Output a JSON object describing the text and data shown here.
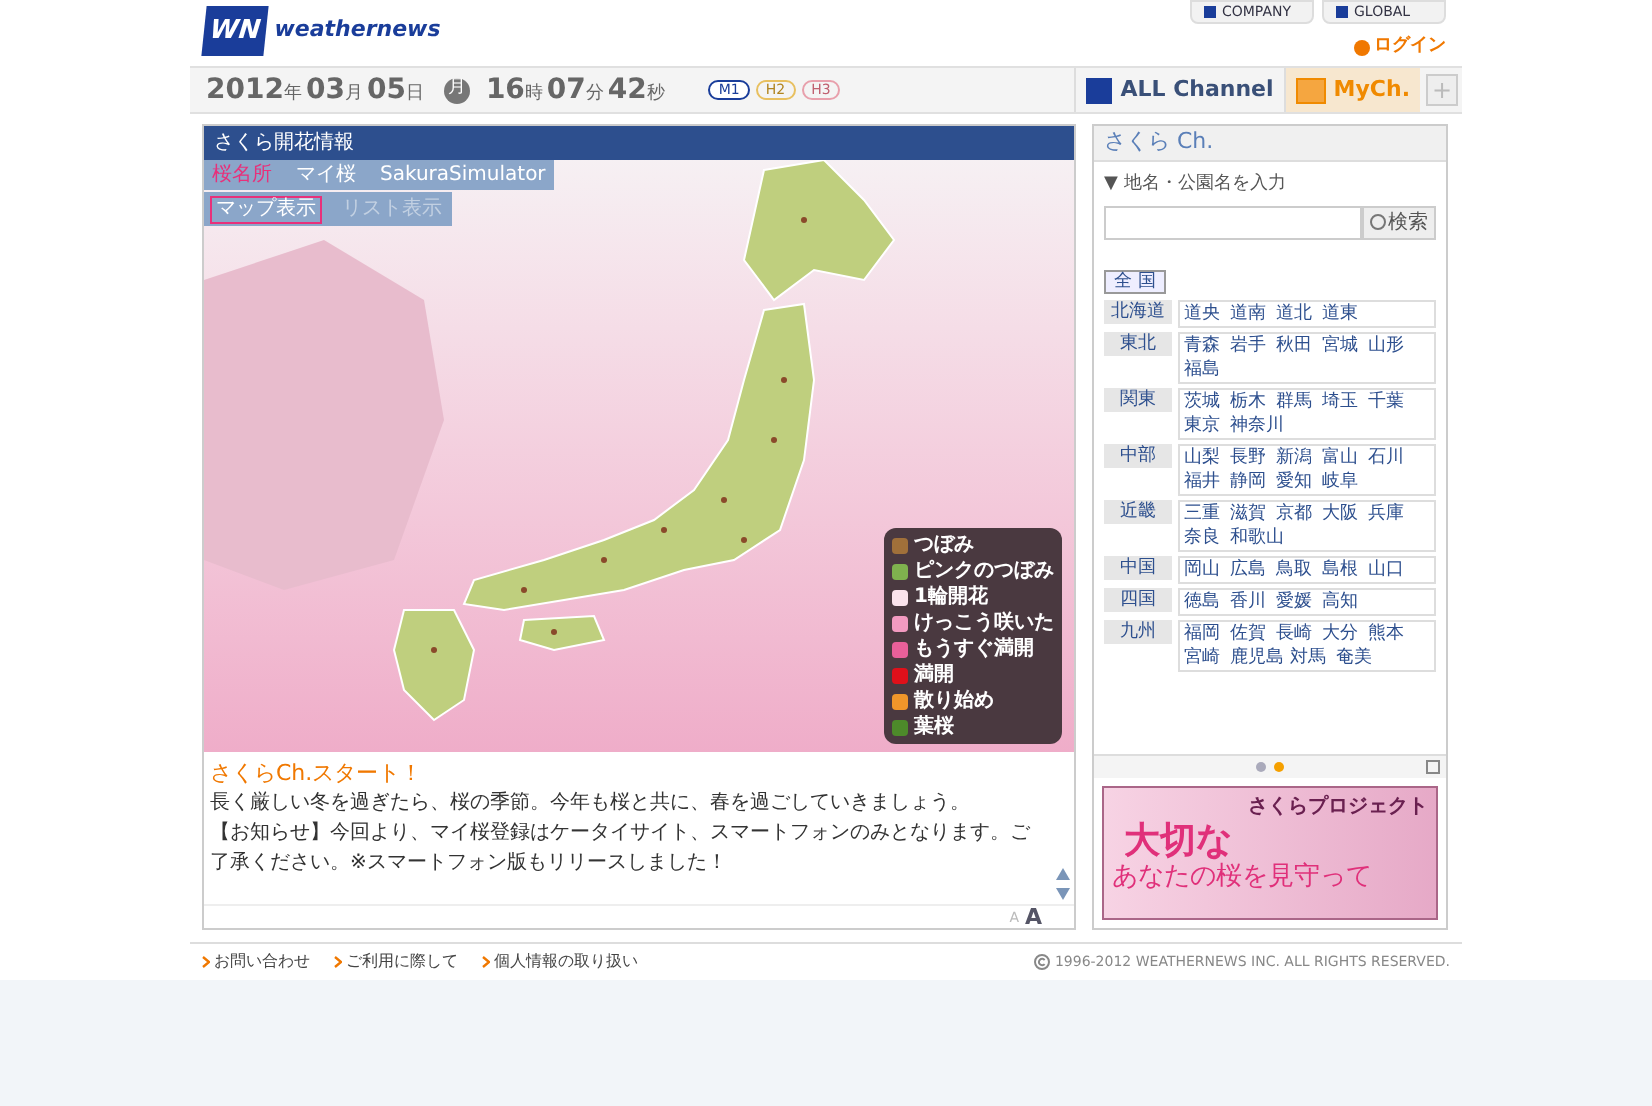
{
  "header": {
    "logo_mark": "WN",
    "logo_text": "weathernews",
    "links": [
      "COMPANY",
      "GLOBAL"
    ],
    "login": "ログイン"
  },
  "datebar": {
    "date": [
      {
        "value": "2012",
        "unit": "年"
      },
      {
        "value": "03",
        "unit": "月"
      },
      {
        "value": "05",
        "unit": "日"
      }
    ],
    "weekday": "月",
    "time": [
      {
        "value": "16",
        "unit": "時"
      },
      {
        "value": "07",
        "unit": "分"
      },
      {
        "value": "42",
        "unit": "秒"
      }
    ],
    "modes": [
      {
        "label": "M1",
        "selected": true
      },
      {
        "label": "H2",
        "selected": false
      },
      {
        "label": "H3",
        "selected": false
      }
    ],
    "channels": [
      {
        "label": "ALL Channel",
        "selected": false
      },
      {
        "label": "MyCh.",
        "selected": true
      }
    ],
    "add": "+"
  },
  "main": {
    "title": "さくら開花情報",
    "tabs": [
      {
        "label": "桜名所",
        "selected": true
      },
      {
        "label": "マイ桜",
        "selected": false
      },
      {
        "label": "SakuraSimulator",
        "selected": false
      }
    ],
    "views": [
      {
        "label": "マップ表示",
        "selected": true
      },
      {
        "label": "リスト表示",
        "selected": false
      }
    ],
    "legend": [
      {
        "label": "つぼみ",
        "color": "#a0703a"
      },
      {
        "label": "ピンクのつぼみ",
        "color": "#7fb24e"
      },
      {
        "label": "1輪開花",
        "color": "#fbe3ec"
      },
      {
        "label": "けっこう咲いた",
        "color": "#f29ac0"
      },
      {
        "label": "もうすぐ満開",
        "color": "#e8609a"
      },
      {
        "label": "満開",
        "color": "#e0101a"
      },
      {
        "label": "散り始め",
        "color": "#f0962a"
      },
      {
        "label": "葉桜",
        "color": "#4d8a2a"
      }
    ],
    "news_title": "さくらCh.スタート！",
    "news_body": [
      "長く厳しい冬を過ぎたら、桜の季節。今年も桜と共に、春を過ごしていきましょう。",
      "【お知らせ】今回より、マイ桜登録はケータイサイト、スマートフォンのみとなります。ご了承ください。※スマートフォン版もリリースしました！"
    ],
    "font_sizes": [
      "A",
      "A"
    ]
  },
  "side": {
    "title": "さくら Ch.",
    "search_label": "▼ 地名・公園名を入力",
    "search_button": "検索",
    "all": "全 国",
    "regions": [
      {
        "name": "北海道",
        "areas": [
          "道央",
          "道南",
          "道北",
          "道東"
        ]
      },
      {
        "name": "東北",
        "areas": [
          "青森",
          "岩手",
          "秋田",
          "宮城",
          "山形",
          "福島"
        ]
      },
      {
        "name": "関東",
        "areas": [
          "茨城",
          "栃木",
          "群馬",
          "埼玉",
          "千葉",
          "東京",
          "神奈川"
        ]
      },
      {
        "name": "中部",
        "areas": [
          "山梨",
          "長野",
          "新潟",
          "富山",
          "石川",
          "福井",
          "静岡",
          "愛知",
          "岐阜"
        ]
      },
      {
        "name": "近畿",
        "areas": [
          "三重",
          "滋賀",
          "京都",
          "大阪",
          "兵庫",
          "奈良",
          "和歌山"
        ]
      },
      {
        "name": "中国",
        "areas": [
          "岡山",
          "広島",
          "鳥取",
          "島根",
          "山口"
        ]
      },
      {
        "name": "四国",
        "areas": [
          "徳島",
          "香川",
          "愛媛",
          "高知"
        ]
      },
      {
        "name": "九州",
        "areas": [
          "福岡",
          "佐賀",
          "長崎",
          "大分",
          "熊本",
          "宮崎",
          "鹿児島",
          "対馬",
          "奄美"
        ]
      }
    ],
    "slides": [
      {
        "selected": false
      },
      {
        "selected": true
      }
    ],
    "banner": {
      "kicker": "さくらプロジェクト",
      "line1": "大切な",
      "line2": "あなたの桜を見守って"
    }
  },
  "footer": {
    "links": [
      "お問い合わせ",
      "ご利用に際して",
      "個人情報の取り扱い"
    ],
    "copyright": "1996-2012 WEATHERNEWS INC. ALL RIGHTS RESERVED."
  }
}
